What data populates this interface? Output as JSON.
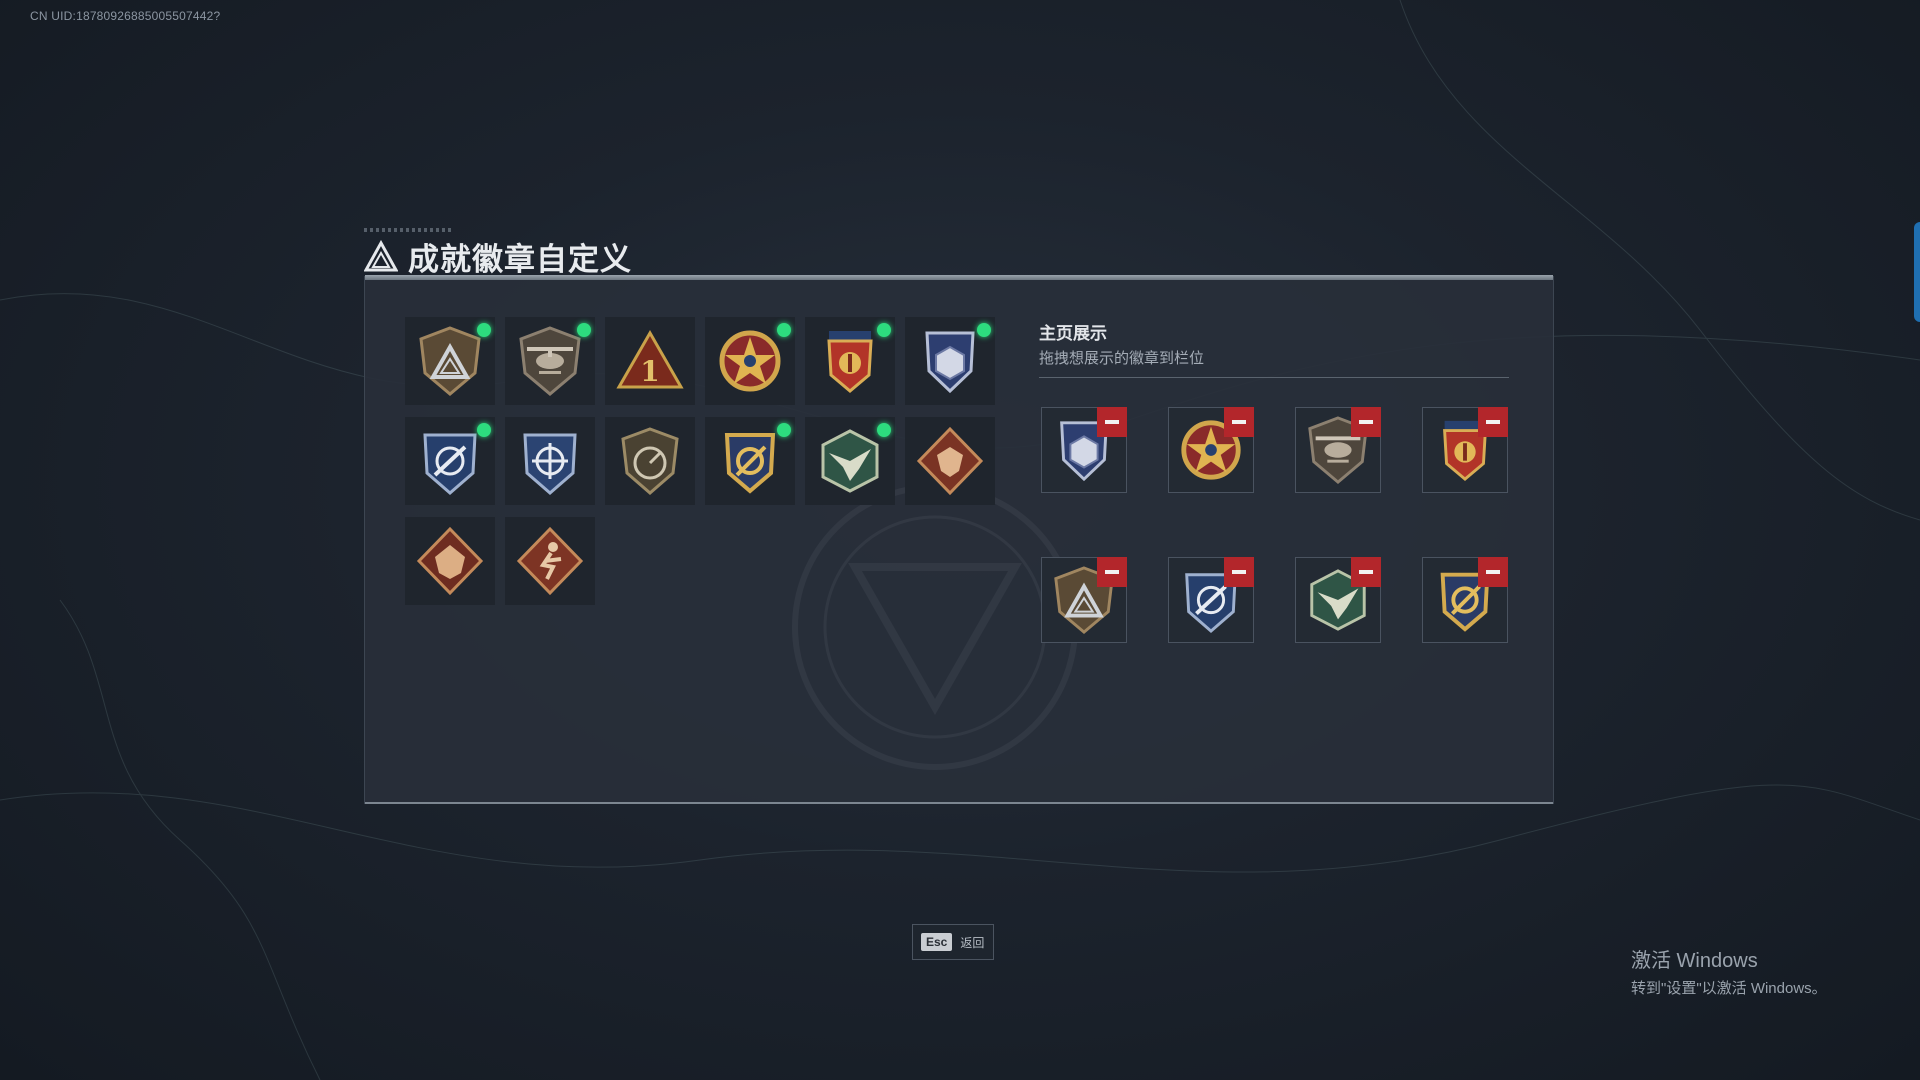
{
  "uid_text": "CN UID:18780926885005507442?",
  "title": "成就徽章自定义",
  "collection": {
    "badges": [
      {
        "icon": "triangle-shield-badge-icon",
        "equipped": true
      },
      {
        "icon": "helicopter-badge-icon",
        "equipped": true
      },
      {
        "icon": "rank-one-badge-icon",
        "equipped": false
      },
      {
        "icon": "gold-star-medal-badge-icon",
        "equipped": true
      },
      {
        "icon": "red-star-crest-badge-icon",
        "equipped": true
      },
      {
        "icon": "blue-hex-crest-badge-icon",
        "equipped": true
      },
      {
        "icon": "blue-crosshair-shield-badge-icon",
        "equipped": true
      },
      {
        "icon": "blue-crosshair-shield-alt-badge-icon",
        "equipped": false
      },
      {
        "icon": "gauge-shield-badge-icon",
        "equipped": false
      },
      {
        "icon": "gold-anchor-crest-badge-icon",
        "equipped": true
      },
      {
        "icon": "green-hex-bird-badge-icon",
        "equipped": true
      },
      {
        "icon": "red-dragon-badge-icon",
        "equipped": false
      },
      {
        "icon": "red-dragon-alt-badge-icon",
        "equipped": false
      },
      {
        "icon": "red-runner-badge-icon",
        "equipped": false
      }
    ]
  },
  "showcase": {
    "title": "主页展示",
    "subtitle": "拖拽想展示的徽章到栏位",
    "slots": [
      {
        "icon": "blue-hex-crest-badge-icon"
      },
      {
        "icon": "gold-star-medal-badge-icon"
      },
      {
        "icon": "helicopter-badge-icon"
      },
      {
        "icon": "red-star-crest-badge-icon"
      },
      {
        "icon": "triangle-shield-badge-icon"
      },
      {
        "icon": "blue-crosshair-shield-badge-icon"
      },
      {
        "icon": "green-hex-bird-badge-icon"
      },
      {
        "icon": "gold-anchor-crest-badge-icon"
      }
    ]
  },
  "footer": {
    "esc_key": "Esc",
    "esc_label": "返回"
  },
  "windows_activation": {
    "line1": "激活 Windows",
    "line2": "转到\"设置\"以激活 Windows。"
  },
  "colors": {
    "equipped_dot": "#2ddc7e",
    "remove_button": "#b3262b",
    "accent": "#1f6fb1"
  }
}
